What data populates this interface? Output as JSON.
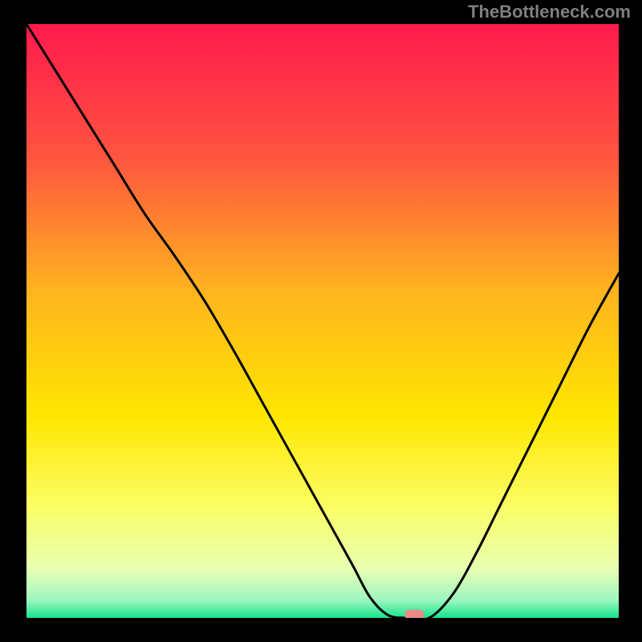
{
  "watermark": "TheBottleneck.com",
  "chart_data": {
    "type": "line",
    "title": "",
    "xlabel": "",
    "ylabel": "",
    "xlim": [
      0,
      100
    ],
    "ylim": [
      0,
      100
    ],
    "grid": false,
    "legend": false,
    "series": [
      {
        "name": "curve",
        "x": [
          0.0,
          5.0,
          10.0,
          15.0,
          20.0,
          25.0,
          30.0,
          35.0,
          40.0,
          45.0,
          50.0,
          55.0,
          58.0,
          61.0,
          64.0,
          68.0,
          72.0,
          76.0,
          80.0,
          85.0,
          90.0,
          95.0,
          100.0
        ],
        "y": [
          100.0,
          92.0,
          84.0,
          76.0,
          68.0,
          61.0,
          53.5,
          45.0,
          36.0,
          27.0,
          18.0,
          9.0,
          3.5,
          0.5,
          0.0,
          0.0,
          4.0,
          11.0,
          19.0,
          29.0,
          39.0,
          49.0,
          58.0
        ]
      }
    ],
    "minimum_marker": {
      "x": 65.5,
      "y": 0.5
    },
    "background_gradient": {
      "stops": [
        {
          "pct": 0,
          "color": "#ff1a4d"
        },
        {
          "pct": 22,
          "color": "#ff5340"
        },
        {
          "pct": 45,
          "color": "#ffb41f"
        },
        {
          "pct": 66,
          "color": "#ffe600"
        },
        {
          "pct": 82,
          "color": "#fbff6a"
        },
        {
          "pct": 92,
          "color": "#e6ffb3"
        },
        {
          "pct": 97,
          "color": "#9cf7c0"
        },
        {
          "pct": 100,
          "color": "#16e38a"
        }
      ]
    },
    "marker_color": "#e98b86",
    "line_color": "#000000"
  }
}
